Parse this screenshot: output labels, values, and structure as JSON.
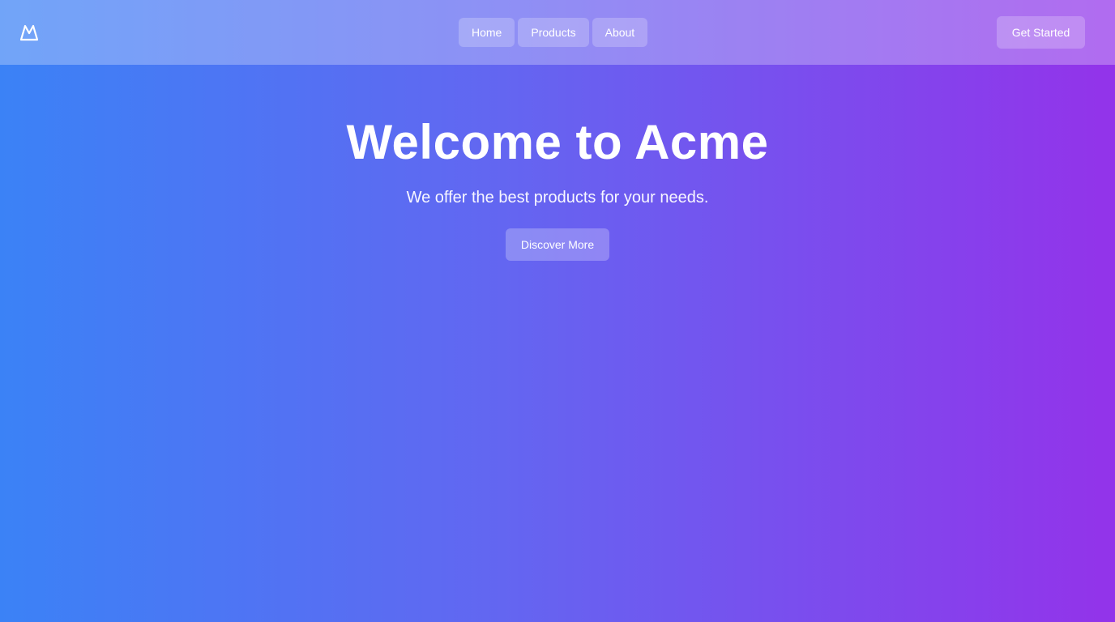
{
  "header": {
    "logo_icon": "mountain-icon",
    "nav": [
      {
        "label": "Home"
      },
      {
        "label": "Products"
      },
      {
        "label": "About"
      }
    ],
    "cta_label": "Get Started"
  },
  "hero": {
    "title": "Welcome to Acme",
    "subtitle": "We offer the best products for your needs.",
    "button_label": "Discover More"
  },
  "colors": {
    "gradient_start": "#3b82f6",
    "gradient_mid": "#6366f1",
    "gradient_end": "#9333ea",
    "text": "#ffffff"
  }
}
